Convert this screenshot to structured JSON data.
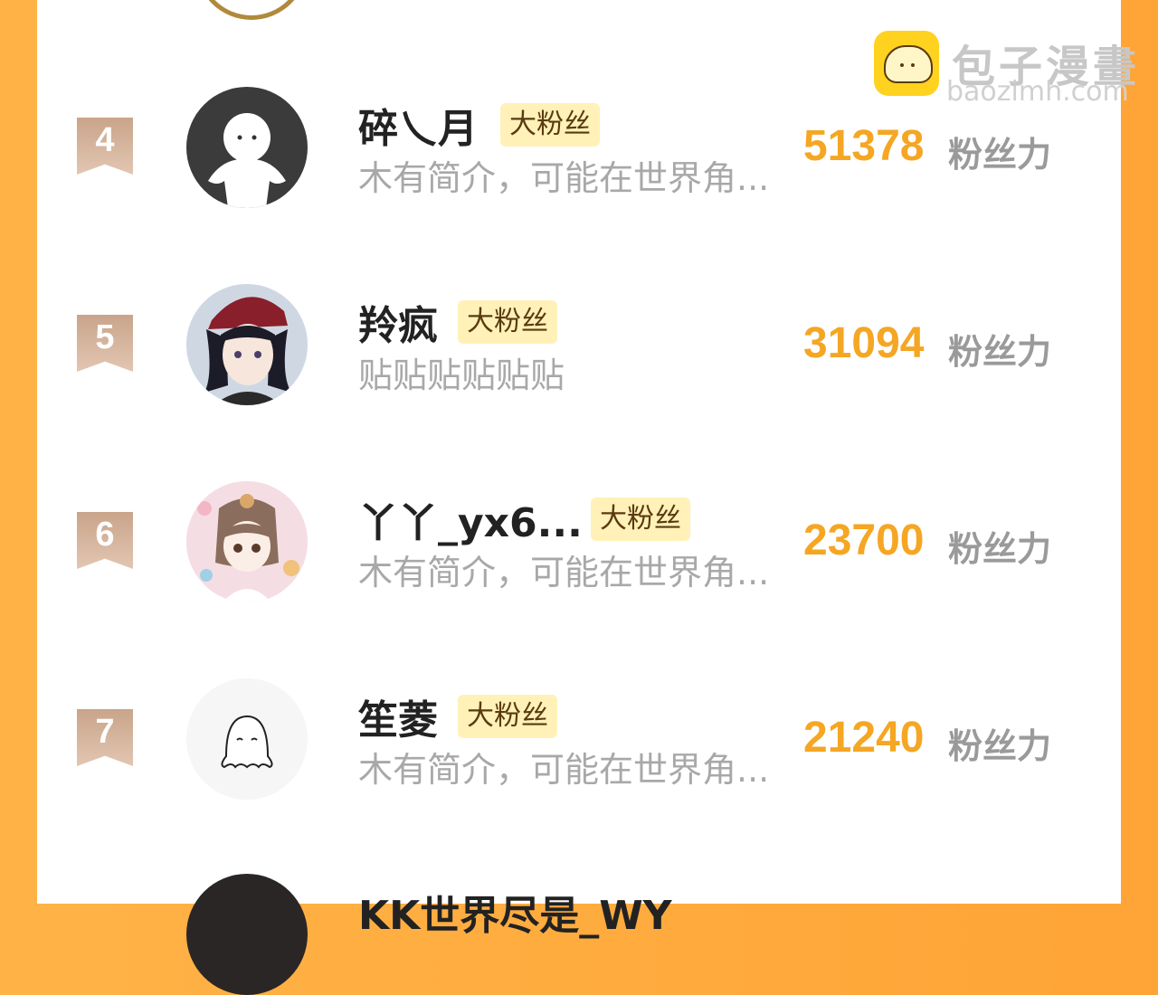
{
  "watermark": {
    "title": "包子漫畫",
    "url": "baozimh.com"
  },
  "score_unit": "粉丝力",
  "rows": [
    {
      "rank": "4",
      "name": "碎乀月",
      "badge": "大粉丝",
      "bio": "木有简介，可能在世界角...",
      "score": "51378",
      "avatar": "ghost-avatar"
    },
    {
      "rank": "5",
      "name": "羚疯",
      "badge": "大粉丝",
      "bio": "贴贴贴贴贴贴",
      "score": "31094",
      "avatar": "anime-girl-cap-avatar"
    },
    {
      "rank": "6",
      "name": "丫丫_yx6...",
      "badge": "大粉丝",
      "bio": "木有简介，可能在世界角...",
      "score": "23700",
      "avatar": "anime-girl-bunny-avatar"
    },
    {
      "rank": "7",
      "name": "笙菱",
      "badge": "大粉丝",
      "bio": "木有简介，可能在世界角...",
      "score": "21240",
      "avatar": "white-ghost-avatar"
    }
  ],
  "next_row_partial_name": "KK世界尽是_WY"
}
